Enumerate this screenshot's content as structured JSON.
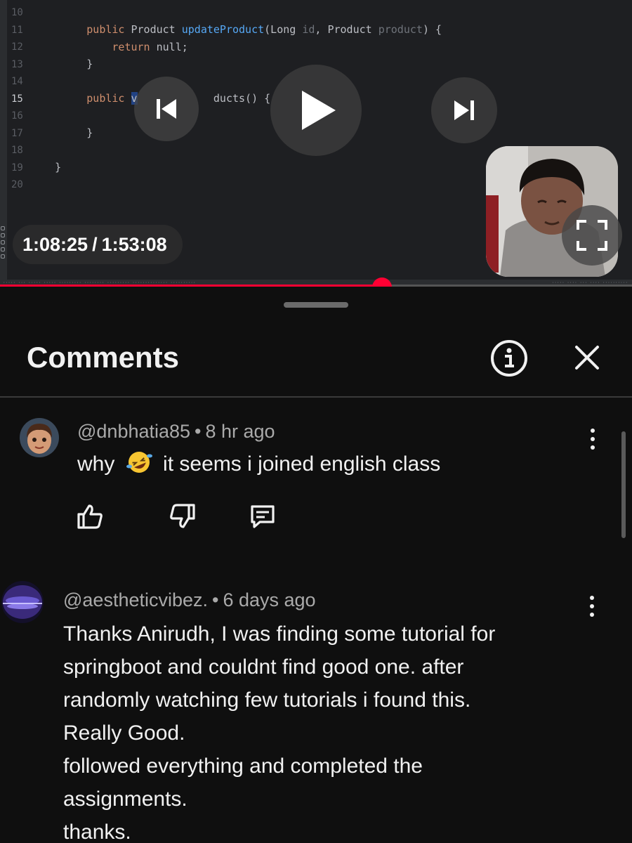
{
  "editor": {
    "line_numbers": [
      "10",
      "11",
      "12",
      "13",
      "14",
      "15",
      "16",
      "17",
      "18",
      "19",
      "20"
    ],
    "active_line": "15",
    "code": {
      "l11_kw": "public",
      "l11_type": " Product ",
      "l11_fn": "updateProduct",
      "l11_a": "(Long ",
      "l11_p1": "id",
      "l11_b": ", Product ",
      "l11_p2": "product",
      "l11_c": ") {",
      "l12_kw": "return",
      "l12_rest": " null;",
      "l13": "}",
      "l15_kw": "public",
      "l15_sel": "v",
      "l15_rest": "ducts() {",
      "l17": "}",
      "l19": "}"
    }
  },
  "player": {
    "current_time": "1:08:25",
    "separator": "/",
    "duration": "1:53:08",
    "progress_fraction": 0.604
  },
  "comments_panel": {
    "title": "Comments",
    "comments": [
      {
        "author": "@dnbhatia85",
        "time": "8 hr ago",
        "text_before_emoji": "why",
        "text_after_emoji": "it seems i joined english class"
      },
      {
        "author": "@aestheticvibez.",
        "time": "6 days ago",
        "lines": [
          "Thanks Anirudh, I was finding some tutorial for",
          "springboot and couldnt find good one. after",
          "randomly watching few tutorials i found this.",
          "Really Good.",
          "followed everything and completed the",
          "assignments.",
          "thanks."
        ]
      }
    ]
  },
  "colors": {
    "progress": "#ff0033",
    "background": "#0f0f0f",
    "text": "#f1f1f1",
    "meta": "#aaaaaa"
  },
  "icons": [
    "previous-icon",
    "play-icon",
    "next-icon",
    "fullscreen-icon",
    "info-icon",
    "close-icon",
    "like-icon",
    "dislike-icon",
    "reply-icon",
    "more-vert-icon"
  ]
}
